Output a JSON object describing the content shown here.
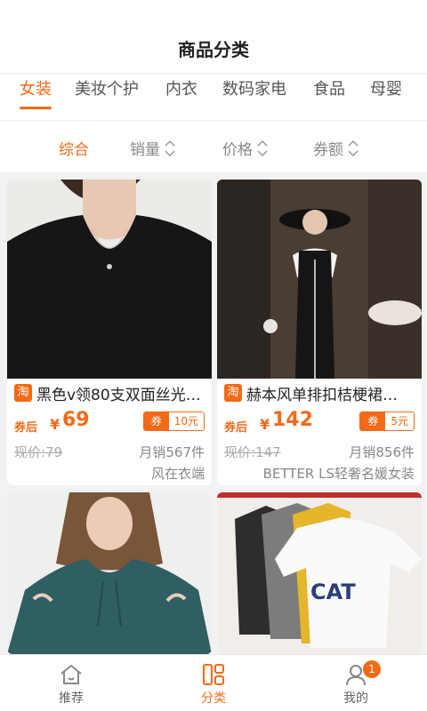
{
  "header": {
    "title": "商品分类"
  },
  "tabs": [
    {
      "label": "女装",
      "active": true
    },
    {
      "label": "美妆个护",
      "active": false
    },
    {
      "label": "内衣",
      "active": false
    },
    {
      "label": "数码家电",
      "active": false
    },
    {
      "label": "食品",
      "active": false
    },
    {
      "label": "母婴",
      "active": false
    }
  ],
  "sort": [
    {
      "label": "综合",
      "active": true
    },
    {
      "label": "销量",
      "active": false
    },
    {
      "label": "价格",
      "active": false
    },
    {
      "label": "券额",
      "active": false
    }
  ],
  "products": [
    {
      "platform_icon": "淘",
      "name": "黑色v领80支双面丝光…",
      "after_label": "券后",
      "currency": "¥",
      "price": "69",
      "coupon_tag": "券",
      "coupon_amount": "10元",
      "original_price": "现价:79",
      "sales": "月销567件",
      "shop": "风在衣端"
    },
    {
      "platform_icon": "淘",
      "name": "赫本风单排扣桔梗裙…",
      "after_label": "券后",
      "currency": "¥",
      "price": "142",
      "coupon_tag": "券",
      "coupon_amount": "5元",
      "original_price": "现价:147",
      "sales": "月销856件",
      "shop": "BETTER LS轻奢名媛女装"
    }
  ],
  "bottom_nav": [
    {
      "label": "推荐",
      "icon": "home-icon",
      "active": false
    },
    {
      "label": "分类",
      "icon": "category-icon",
      "active": true
    },
    {
      "label": "我的",
      "icon": "user-icon",
      "active": false,
      "badge": "1"
    }
  ],
  "colors": {
    "accent": "#f26a17",
    "background": "#f2f2f2"
  }
}
